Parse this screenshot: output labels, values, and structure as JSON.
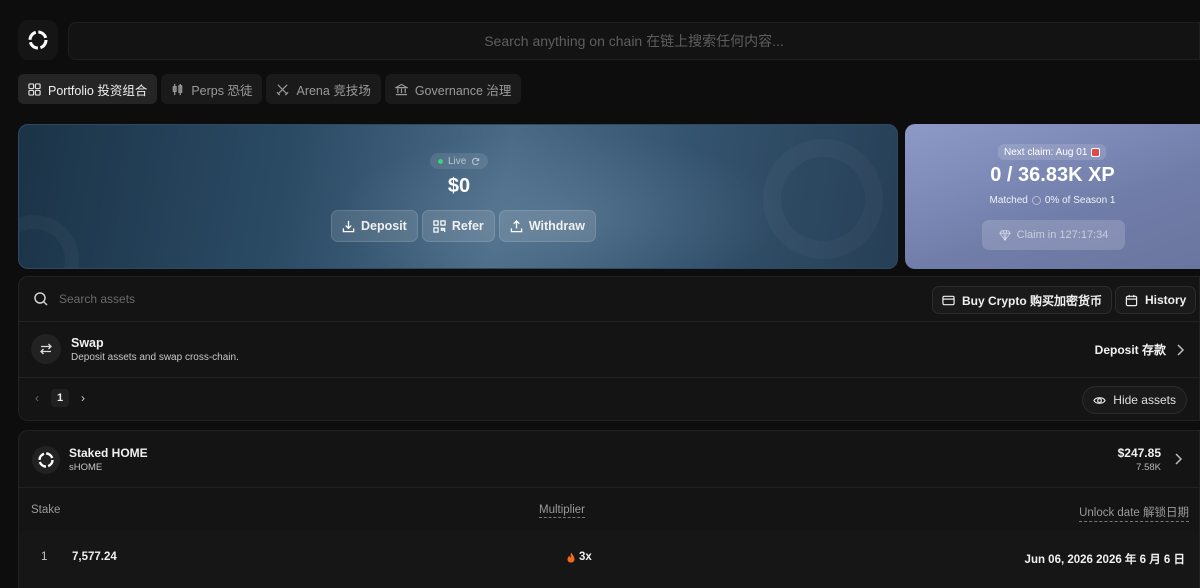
{
  "header": {
    "search_placeholder": "Search anything on chain  在链上搜索任何内容..."
  },
  "nav": {
    "tabs": [
      {
        "label": "Portfolio 投资组合",
        "icon": "grid-icon",
        "active": true
      },
      {
        "label": "Perps 恐徒",
        "icon": "candles-icon",
        "active": false
      },
      {
        "label": "Arena 竞技场",
        "icon": "swords-icon",
        "active": false
      },
      {
        "label": "Governance 治理",
        "icon": "bank-icon",
        "active": false
      }
    ]
  },
  "balance": {
    "live_label": "Live",
    "value": "$0",
    "actions": {
      "deposit": "Deposit",
      "refer": "Refer",
      "withdraw": "Withdraw"
    }
  },
  "xp": {
    "next_claim": "Next claim: Aug 01",
    "value": "0 / 36.83K XP",
    "matched_label": "Matched",
    "season_label": "0% of Season 1",
    "claim_button": "Claim in 127:17:34"
  },
  "assets": {
    "search_placeholder": "Search assets",
    "buy_crypto": "Buy Crypto 购买加密货币",
    "history": "History",
    "swap": {
      "title": "Swap",
      "description": "Deposit assets and swap cross-chain.",
      "action": "Deposit 存款"
    },
    "pager": {
      "prev": "‹",
      "page": "1",
      "next": "›"
    },
    "hide_assets": "Hide assets"
  },
  "stake": {
    "token_name": "Staked HOME",
    "token_symbol": "sHOME",
    "usd_value": "$247.85",
    "amount": "7.58K",
    "columns": {
      "stake": "Stake",
      "multiplier": "Multiplier",
      "unlock": "Unlock date 解锁日期"
    },
    "rows": [
      {
        "index": "1",
        "amount": "7,577.24",
        "multiplier": "3x",
        "unlock": "Jun 06, 2026  2026 年 6 月 6 日"
      }
    ]
  },
  "colors": {
    "background": "#0d0d0d",
    "xp_card": "#7f8bbb",
    "balance_card": "#2a4a64",
    "live_dot": "#3ad27a"
  }
}
